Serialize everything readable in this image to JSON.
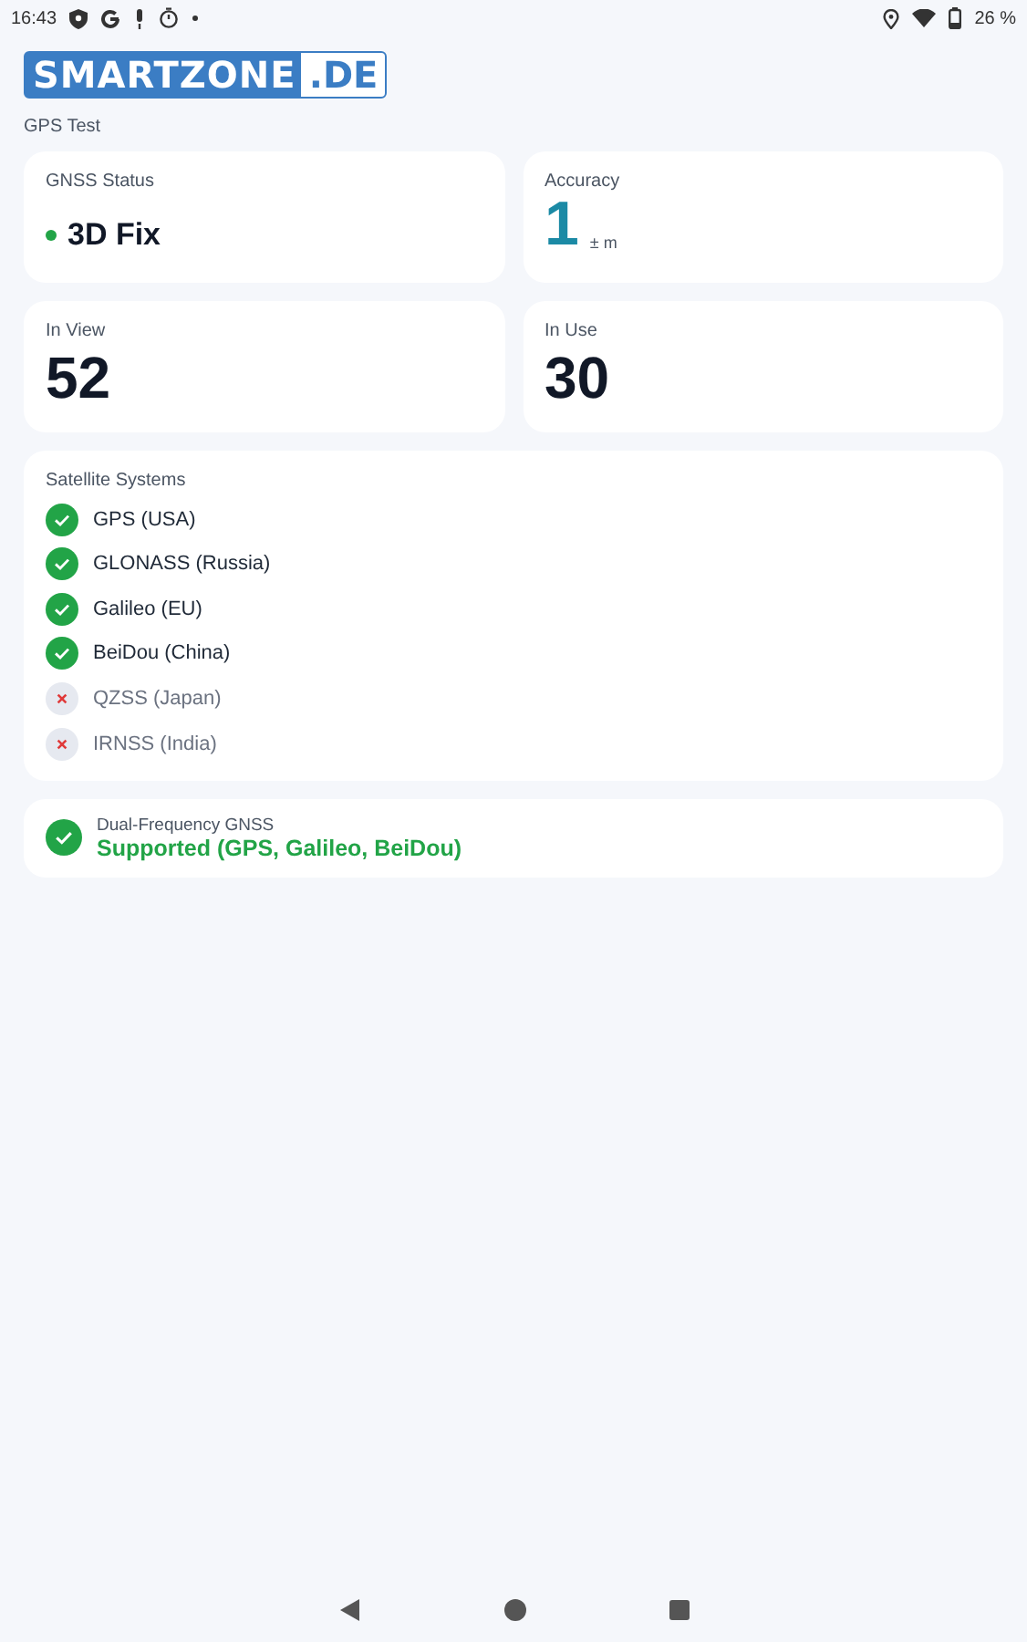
{
  "status_bar": {
    "time": "16:43",
    "battery": "26 %"
  },
  "logo": {
    "main": "SMARTZONE",
    "suffix": ".DE"
  },
  "page_title": "GPS Test",
  "gnss_status": {
    "label": "GNSS Status",
    "value": "3D Fix",
    "color": "#22a447"
  },
  "accuracy": {
    "label": "Accuracy",
    "value": "1",
    "unit": "± m"
  },
  "in_view": {
    "label": "In View",
    "value": "52"
  },
  "in_use": {
    "label": "In Use",
    "value": "30"
  },
  "satellite_systems": {
    "title": "Satellite Systems",
    "items": [
      {
        "name": "GPS (USA)",
        "on": true
      },
      {
        "name": "GLONASS (Russia)",
        "on": true
      },
      {
        "name": "Galileo (EU)",
        "on": true
      },
      {
        "name": "BeiDou (China)",
        "on": true
      },
      {
        "name": "QZSS (Japan)",
        "on": false
      },
      {
        "name": "IRNSS (India)",
        "on": false
      }
    ]
  },
  "dual_frequency": {
    "label": "Dual-Frequency GNSS",
    "value": "Supported (GPS, Galileo, BeiDou)",
    "on": true
  }
}
